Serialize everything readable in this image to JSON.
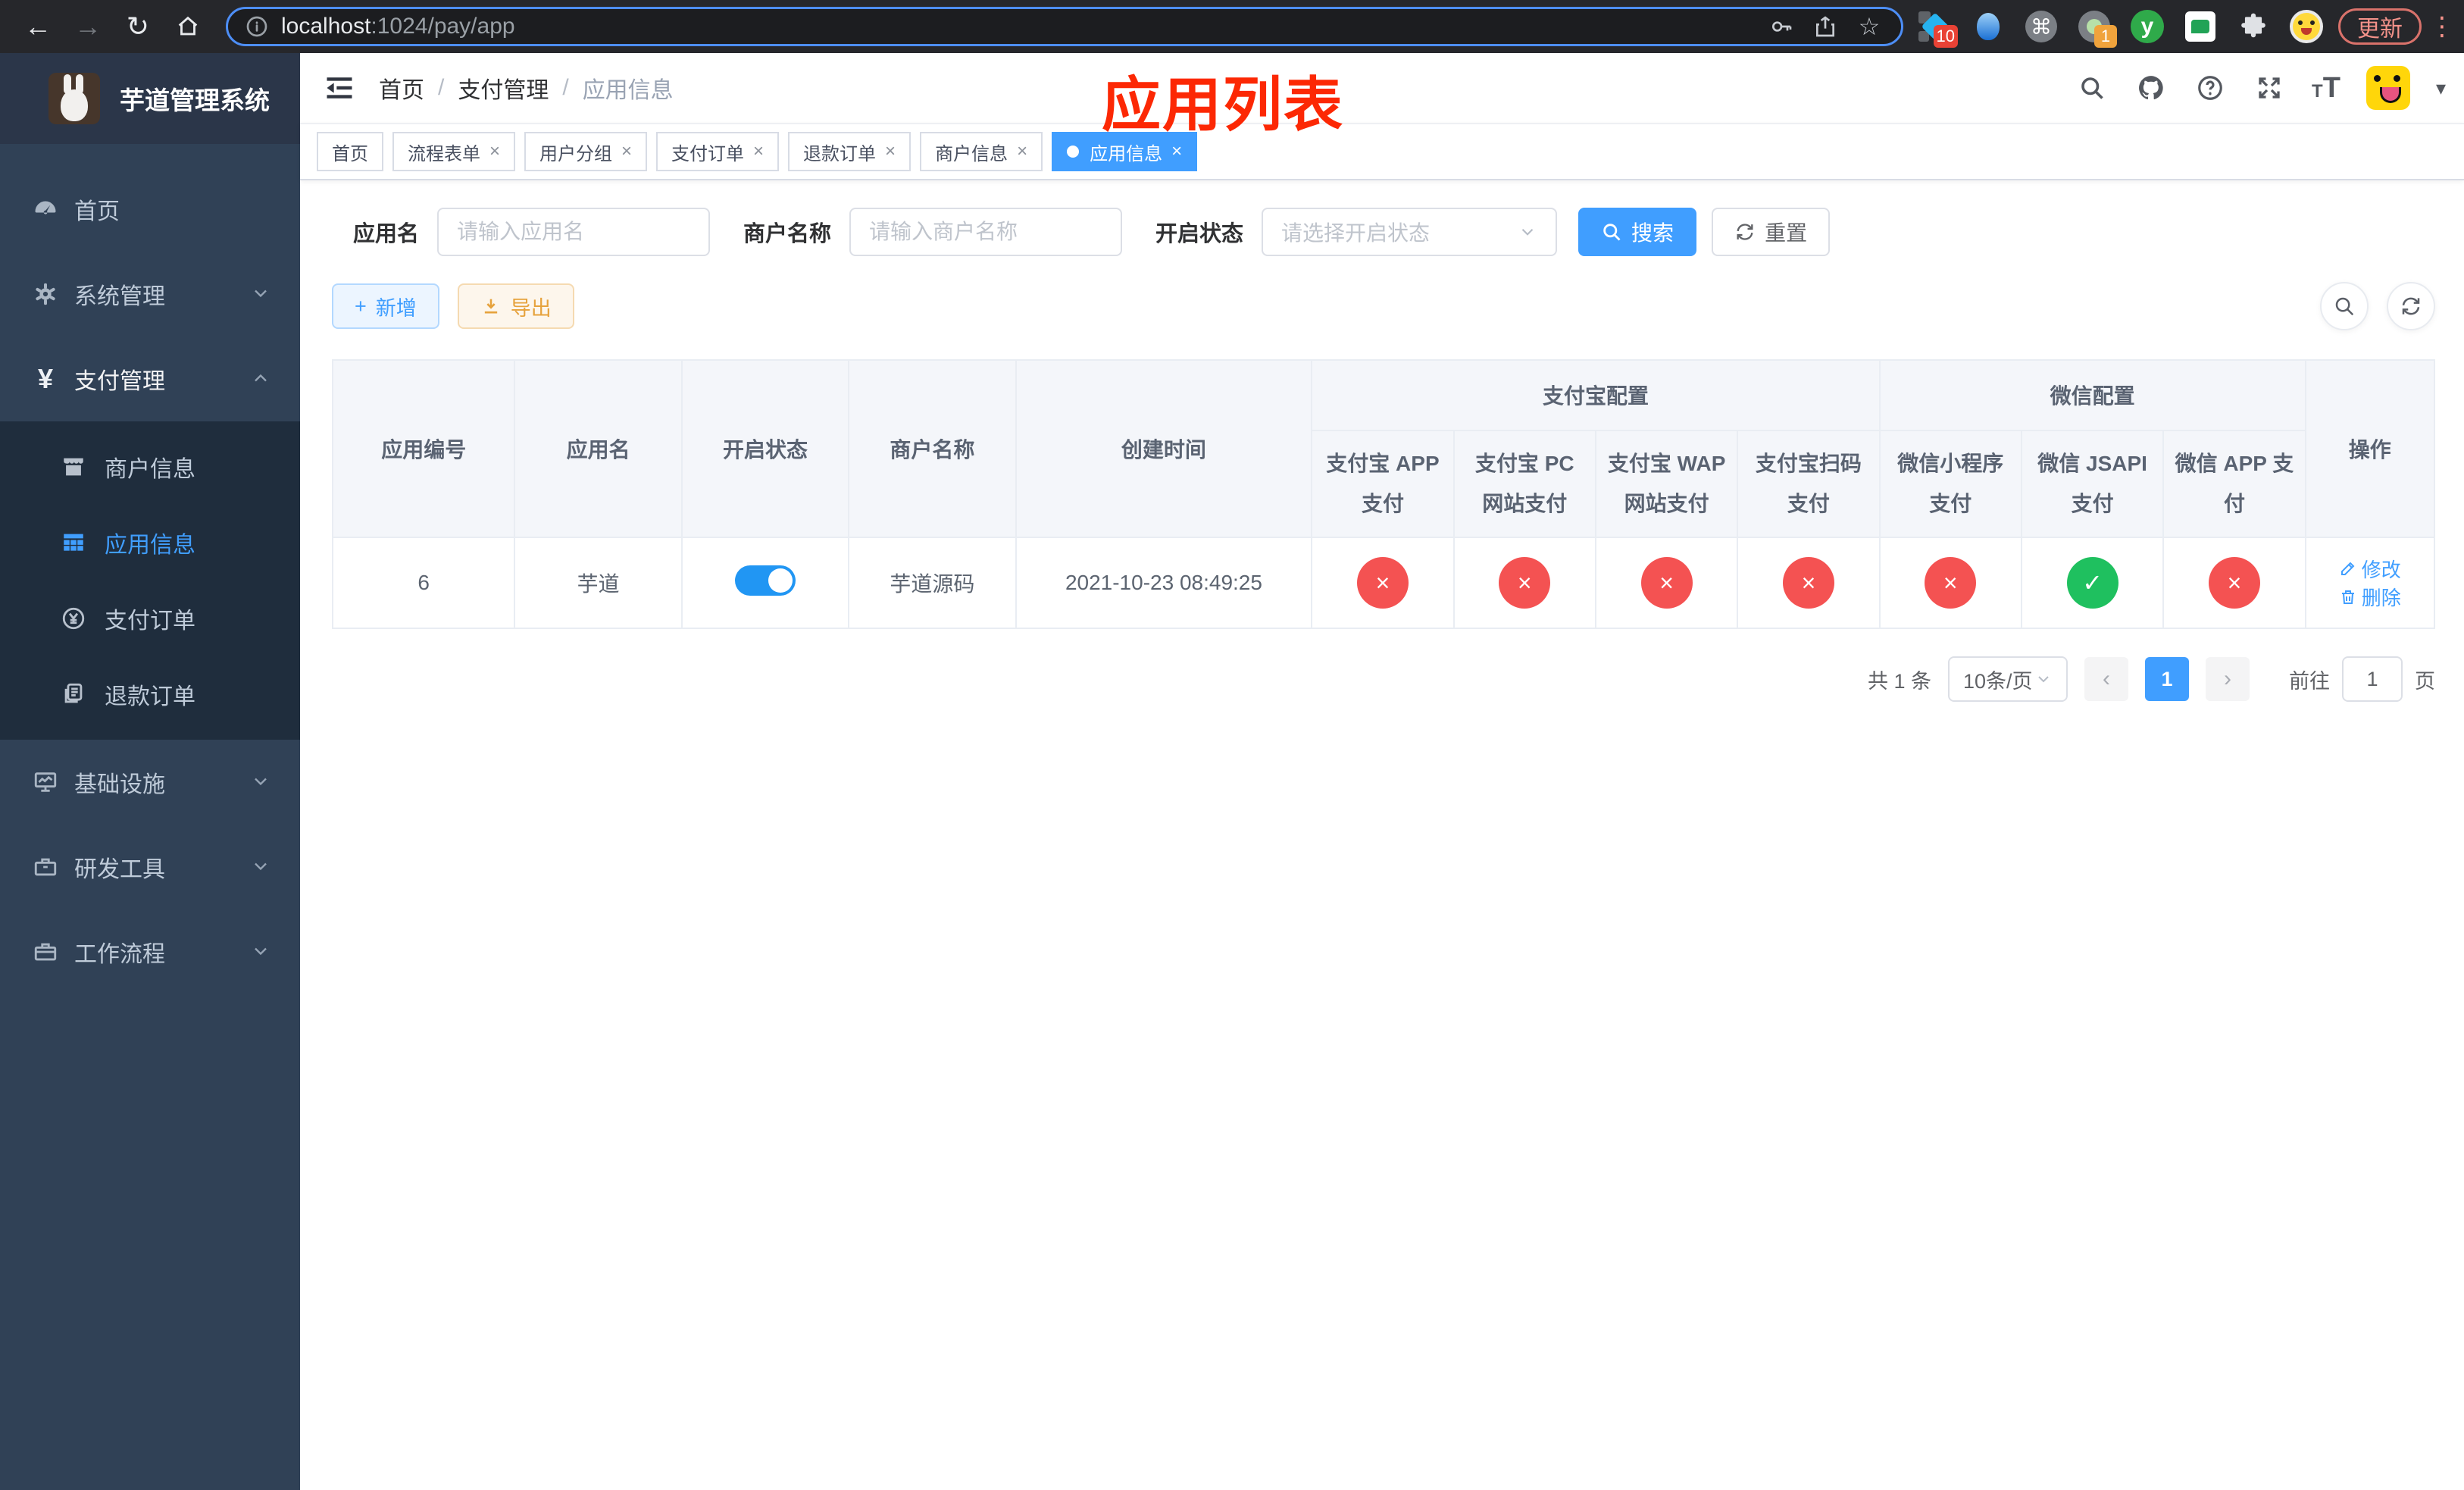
{
  "browser": {
    "url_host": "localhost",
    "url_rest": ":1024/pay/app",
    "ext_badge_1": "10",
    "ext_badge_2": "1",
    "y_logo": "y",
    "update_label": "更新"
  },
  "sidebar": {
    "title": "芋道管理系统",
    "items": [
      {
        "label": "首页"
      },
      {
        "label": "系统管理"
      },
      {
        "label": "支付管理"
      },
      {
        "label": "基础设施"
      },
      {
        "label": "研发工具"
      },
      {
        "label": "工作流程"
      }
    ],
    "submenu": [
      {
        "label": "商户信息"
      },
      {
        "label": "应用信息"
      },
      {
        "label": "支付订单"
      },
      {
        "label": "退款订单"
      }
    ]
  },
  "header": {
    "breadcrumb": [
      "首页",
      "支付管理",
      "应用信息"
    ],
    "annotation": "应用列表"
  },
  "tabs": [
    {
      "label": "首页"
    },
    {
      "label": "流程表单"
    },
    {
      "label": "用户分组"
    },
    {
      "label": "支付订单"
    },
    {
      "label": "退款订单"
    },
    {
      "label": "商户信息"
    },
    {
      "label": "应用信息"
    }
  ],
  "filters": {
    "app_name_label": "应用名",
    "app_name_placeholder": "请输入应用名",
    "merchant_label": "商户名称",
    "merchant_placeholder": "请输入商户名称",
    "status_label": "开启状态",
    "status_placeholder": "请选择开启状态",
    "search_label": "搜索",
    "reset_label": "重置"
  },
  "actions": {
    "add_label": "新增",
    "export_label": "导出"
  },
  "table": {
    "columns": {
      "app_id": "应用编号",
      "app_name": "应用名",
      "status": "开启状态",
      "merchant": "商户名称",
      "created": "创建时间",
      "alipay_group": "支付宝配置",
      "wechat_group": "微信配置",
      "op": "操作",
      "alipay_cols": [
        "支付宝 APP 支付",
        "支付宝 PC 网站支付",
        "支付宝 WAP 网站支付",
        "支付宝扫码支付"
      ],
      "wechat_cols": [
        "微信小程序支付",
        "微信 JSAPI 支付",
        "微信 APP 支付"
      ]
    },
    "row": {
      "app_id": "6",
      "app_name": "芋道",
      "enabled": true,
      "merchant": "芋道源码",
      "created": "2021-10-23 08:49:25",
      "pay_status": [
        false,
        false,
        false,
        false,
        false,
        true,
        false
      ],
      "edit_label": "修改",
      "delete_label": "删除"
    }
  },
  "pagination": {
    "total": "共 1 条",
    "page_size": "10条/页",
    "prev": "‹",
    "current": "1",
    "next": "›",
    "goto_label": "前往",
    "goto_value": "1",
    "page_suffix": "页"
  },
  "colors": {
    "accent": "#409eff",
    "danger": "#f45252",
    "success": "#1fc05f",
    "sidebar_bg": "#304156",
    "submenu_bg": "#1f2d3d",
    "annotation": "#fc2804"
  }
}
